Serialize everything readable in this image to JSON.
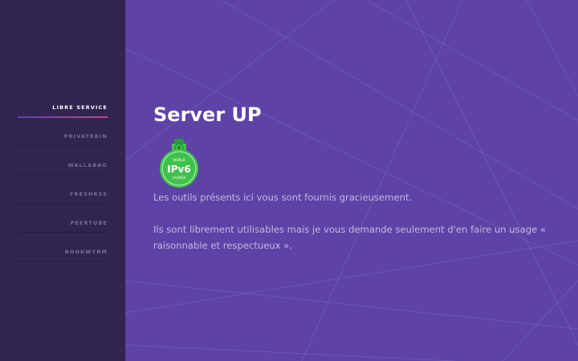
{
  "sidebar": {
    "items": [
      {
        "label": "Libre Service",
        "active": true
      },
      {
        "label": "Privatebin"
      },
      {
        "label": "Wallabag"
      },
      {
        "label": "FreshRSS"
      },
      {
        "label": "Peertube"
      },
      {
        "label": "Bookwyrm"
      }
    ]
  },
  "main": {
    "title": "Server UP",
    "badge": {
      "icon": "ipv6-badge-icon",
      "label": "IPv6",
      "top_text": "WORLD",
      "bottom_text": "LAUNCH"
    },
    "paragraph_1": "Les outils présents ici vous sont fournis gracieusement.",
    "paragraph_2": "Ils sont librement utilisables mais je vous demande seulement d'en faire un usage « raisonnable et respectueux »."
  },
  "colors": {
    "sidebar_bg": "#312450",
    "main_bg": "#5e42a6",
    "accent_gradient_start": "#5e42a6",
    "accent_gradient_end": "#b74e91",
    "badge_green": "#3fc24b"
  }
}
